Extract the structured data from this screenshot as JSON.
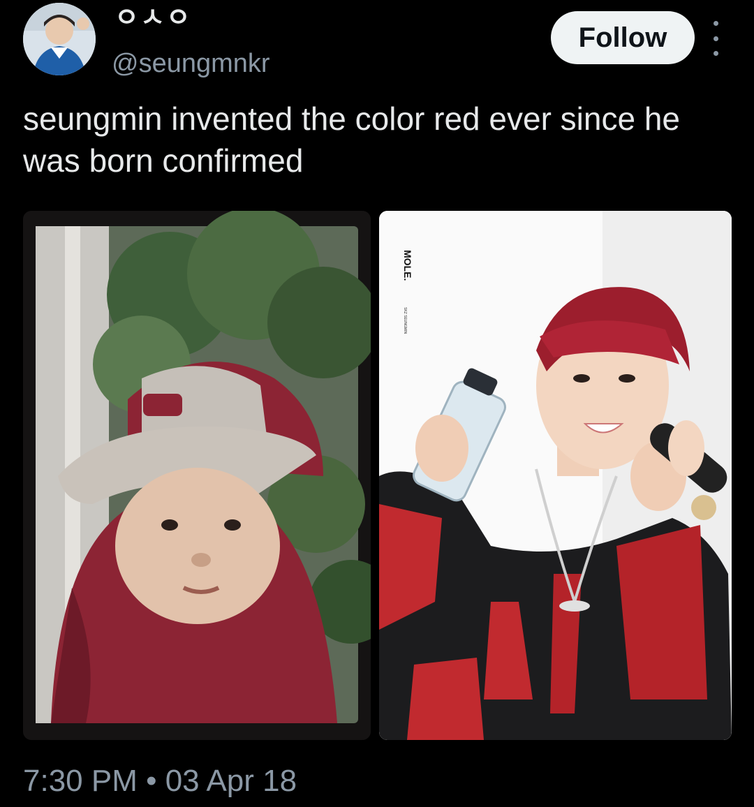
{
  "author": {
    "display_name": "ㅇㅅㅇ",
    "handle": "@seungmnkr",
    "avatar": "profile-photo"
  },
  "actions": {
    "follow_label": "Follow",
    "more_icon": "more-vertical-icon"
  },
  "tweet": {
    "text": "seungmin invented the color red ever since he was born confirmed",
    "timestamp": "7:30 PM • 03 Apr 18"
  },
  "media": {
    "left": {
      "description_icon": "childhood-photocard-image"
    },
    "right": {
      "card_brand": "MOLE.",
      "card_subtext": "SKZ SEUNGMIN"
    }
  },
  "colors": {
    "background": "#000000",
    "primary_text": "#e7e9ea",
    "secondary_text": "#8b98a5",
    "follow_bg": "#eff3f4"
  }
}
